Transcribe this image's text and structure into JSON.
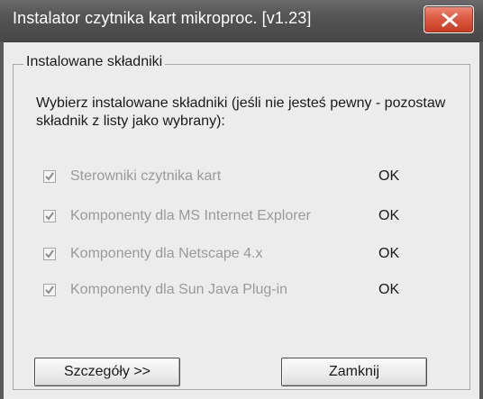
{
  "window": {
    "title": "Instalator czytnika kart mikroproc. [v1.23]"
  },
  "group": {
    "legend": "Instalowane składniki",
    "instructions": "Wybierz instalowane składniki (jeśli nie jesteś pewny - pozostaw składnik z listy jako wybrany):"
  },
  "components": [
    {
      "label": "Sterowniki czytnika kart",
      "status": "OK",
      "checked": true
    },
    {
      "label": "Komponenty dla MS Internet Explorer",
      "status": "OK",
      "checked": true
    },
    {
      "label": "Komponenty dla Netscape 4.x",
      "status": "OK",
      "checked": true
    },
    {
      "label": "Komponenty dla Sun Java Plug-in",
      "status": "OK",
      "checked": true
    }
  ],
  "buttons": {
    "details": "Szczegóły >>",
    "close": "Zamknij"
  },
  "colors": {
    "close_button": "#d9523a",
    "titlebar": "#555555",
    "disabled_text": "#9a9a9a"
  }
}
